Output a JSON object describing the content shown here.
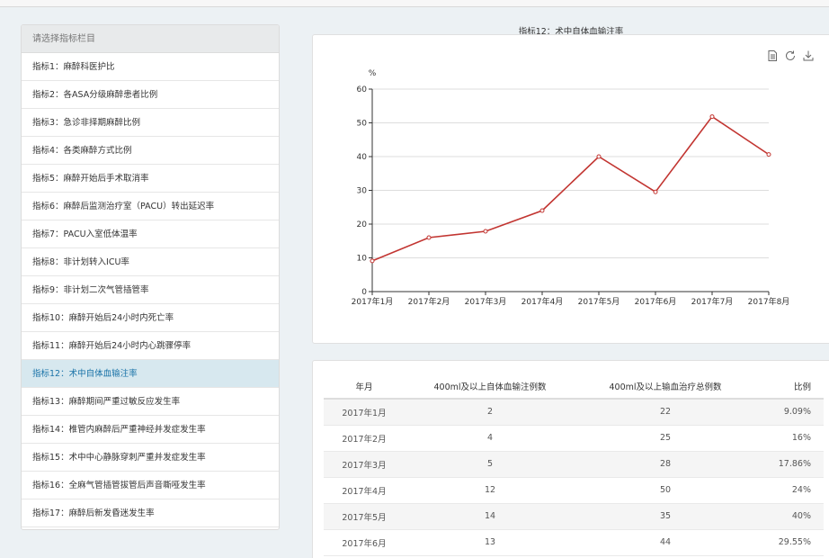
{
  "sidebar": {
    "header": "请选择指标栏目",
    "items": [
      {
        "label": "指标1：麻醉科医护比"
      },
      {
        "label": "指标2：各ASA分级麻醉患者比例"
      },
      {
        "label": "指标3：急诊非择期麻醉比例"
      },
      {
        "label": "指标4：各类麻醉方式比例"
      },
      {
        "label": "指标5：麻醉开始后手术取消率"
      },
      {
        "label": "指标6：麻醉后监测治疗室（PACU）转出延迟率"
      },
      {
        "label": "指标7：PACU入室低体温率"
      },
      {
        "label": "指标8：非计划转入ICU率"
      },
      {
        "label": "指标9：非计划二次气管插管率"
      },
      {
        "label": "指标10：麻醉开始后24小时内死亡率"
      },
      {
        "label": "指标11：麻醉开始后24小时内心跳骤停率"
      },
      {
        "label": "指标12：术中自体血输注率"
      },
      {
        "label": "指标13：麻醉期间严重过敏反应发生率"
      },
      {
        "label": "指标14：椎管内麻醉后严重神经并发症发生率"
      },
      {
        "label": "指标15：术中中心静脉穿刺严重并发症发生率"
      },
      {
        "label": "指标16：全麻气管插管拔管后声音嘶哑发生率"
      },
      {
        "label": "指标17：麻醉后新发昏迷发生率"
      }
    ],
    "active_index": 11
  },
  "toolbox": {
    "icons": [
      "data-view-icon",
      "refresh-icon",
      "download-icon"
    ]
  },
  "chart_data": {
    "type": "line",
    "title": "指标12：术中自体血输注率",
    "ylabel": "%",
    "categories": [
      "2017年1月",
      "2017年2月",
      "2017年3月",
      "2017年4月",
      "2017年5月",
      "2017年6月",
      "2017年7月",
      "2017年8月"
    ],
    "values": [
      9.09,
      16,
      17.86,
      24,
      40,
      29.55,
      51.85,
      40.63
    ],
    "ylim": [
      0,
      60
    ],
    "yticks": [
      0,
      10,
      20,
      30,
      40,
      50,
      60
    ],
    "grid": true,
    "color": "#c23531"
  },
  "table": {
    "headers": [
      "年月",
      "400ml及以上自体血输注例数",
      "400ml及以上输血治疗总例数",
      "比例"
    ],
    "rows": [
      [
        "2017年1月",
        "2",
        "22",
        "9.09%"
      ],
      [
        "2017年2月",
        "4",
        "25",
        "16%"
      ],
      [
        "2017年3月",
        "5",
        "28",
        "17.86%"
      ],
      [
        "2017年4月",
        "12",
        "50",
        "24%"
      ],
      [
        "2017年5月",
        "14",
        "35",
        "40%"
      ],
      [
        "2017年6月",
        "13",
        "44",
        "29.55%"
      ]
    ]
  }
}
